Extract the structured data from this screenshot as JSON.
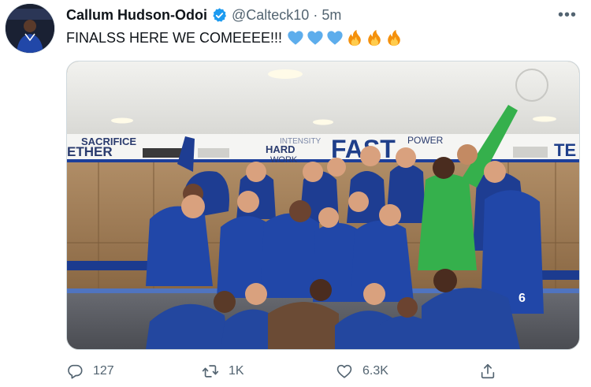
{
  "tweet": {
    "author_name": "Callum Hudson-Odoi",
    "handle": "@Calteck10",
    "separator": "·",
    "time": "5m",
    "more_label": "•••",
    "text": "FINALSS HERE WE COMEEEE!!!",
    "emojis": [
      "blue-heart-icon",
      "blue-heart-icon",
      "blue-heart-icon",
      "fire-icon",
      "fire-icon",
      "fire-icon"
    ]
  },
  "media": {
    "wall_words": [
      "SACRIFICE",
      "ETHER",
      "HARD",
      "WORK",
      "INTENSITY",
      "FAST",
      "POWER",
      "TE"
    ],
    "kit_number": "6"
  },
  "actions": {
    "replies": "127",
    "retweets": "1K",
    "likes": "6.3K"
  },
  "colors": {
    "verified": "#1d9bf0",
    "text_secondary": "#536471",
    "kit_blue": "#1d3f9a",
    "goalkeeper_green": "#35b04c"
  }
}
